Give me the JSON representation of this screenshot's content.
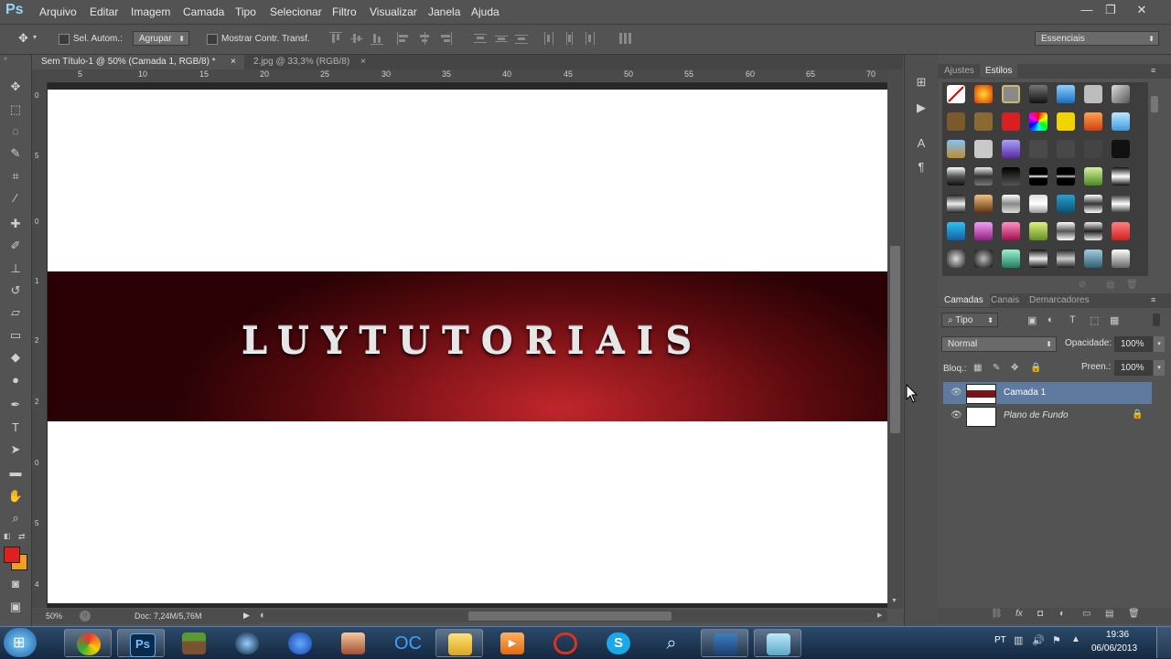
{
  "app": {
    "logo": "Ps"
  },
  "menu": [
    "Arquivo",
    "Editar",
    "Imagem",
    "Camada",
    "Tipo",
    "Selecionar",
    "Filtro",
    "Visualizar",
    "Janela",
    "Ajuda"
  ],
  "options": {
    "auto_select_label": "Sel. Autom.:",
    "group_value": "Agrupar",
    "show_transform_label": "Mostrar Contr. Transf.",
    "workspace": "Essenciais"
  },
  "tabs": [
    {
      "label": "Sem Título-1 @ 50% (Camada 1, RGB/8) *",
      "close": "×",
      "active": true
    },
    {
      "label": "2.jpg @ 33,3% (RGB/8)",
      "close": "×",
      "active": false
    }
  ],
  "ruler": {
    "h": [
      "5",
      "10",
      "15",
      "20",
      "25",
      "30",
      "35",
      "40",
      "45",
      "50",
      "55",
      "60",
      "65",
      "70"
    ],
    "v": [
      "0",
      "5",
      "0",
      "1",
      "2",
      "2",
      "0",
      "5",
      "4"
    ]
  },
  "canvas": {
    "banner_text": "LUYTUTORIAIS"
  },
  "status": {
    "zoom": "50%",
    "doc": "Doc: 7,24M/5,76M"
  },
  "adjust_panel": {
    "tab_adjust": "Ajustes",
    "tab_styles": "Estilos"
  },
  "layers_panel": {
    "tab_layers": "Camadas",
    "tab_channels": "Canais",
    "tab_paths": "Demarcadores",
    "filter_kind": "Tipo",
    "blend_mode": "Normal",
    "opacity_label": "Opacidade:",
    "opacity_value": "100%",
    "lock_label": "Bloq.:",
    "fill_label": "Preen.:",
    "fill_value": "100%",
    "layers": [
      {
        "name": "Camada 1",
        "selected": true
      },
      {
        "name": "Plano de Fundo",
        "selected": false,
        "locked": true
      }
    ]
  },
  "taskbar": {
    "apps": [
      "chrome",
      "photoshop",
      "minecraft",
      "steam",
      "firefox",
      "character",
      "ooc",
      "folder",
      "media-player",
      "color-app",
      "skype",
      "search",
      "film-app",
      "notepad"
    ],
    "lang": "PT",
    "time": "19:36",
    "date": "06/06/2013"
  },
  "colors": {
    "foreground": "#e0201c",
    "background": "#f0a020",
    "selected_layer": "#5e7a9e"
  }
}
